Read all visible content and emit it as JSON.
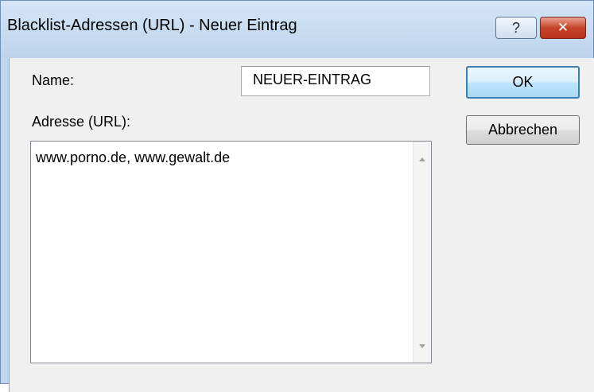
{
  "window": {
    "title": "Blacklist-Adressen (URL) - Neuer Eintrag",
    "help_label": "?",
    "close_label": "✕"
  },
  "form": {
    "name_label": "Name:",
    "name_value": "NEUER-EINTRAG",
    "address_label": "Adresse (URL):",
    "address_value": "www.porno.de, www.gewalt.de"
  },
  "buttons": {
    "ok_label": "OK",
    "cancel_label": "Abbrechen"
  }
}
